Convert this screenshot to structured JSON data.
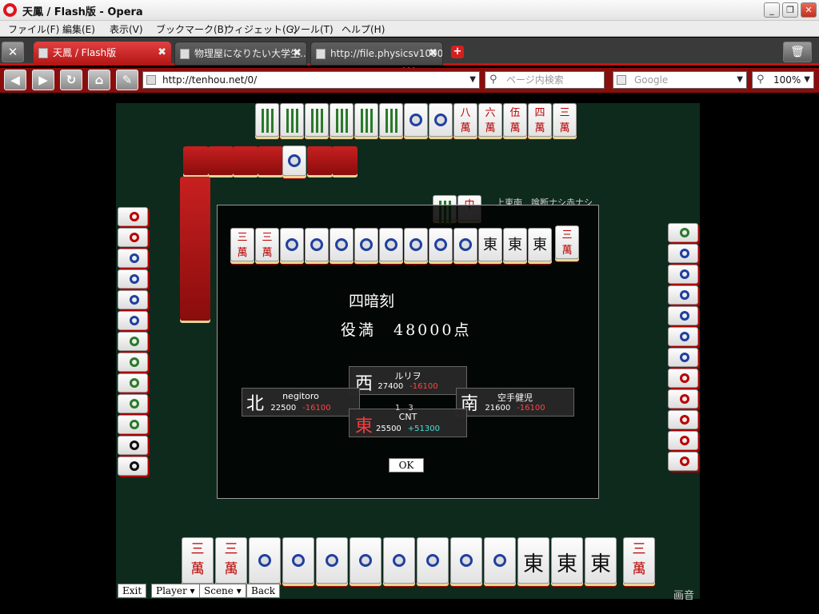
{
  "window": {
    "title": "天鳳 / Flash版 - Opera"
  },
  "menu": [
    "ファイル(F)",
    "編集(E)",
    "表示(V)",
    "ブックマーク(B)",
    "ウィジェット(G)",
    "ツール(T)",
    "ヘルプ(H)"
  ],
  "tabs": [
    {
      "label": "天鳳 / Flash版"
    },
    {
      "label": "物理屋になりたい大学生..."
    },
    {
      "label": "http://file.physicsv1000..."
    }
  ],
  "address": {
    "url": "http://tenhou.net/0/"
  },
  "search": {
    "placeholder": "ページ内検索"
  },
  "engine": {
    "label": "Google"
  },
  "zoom": {
    "label": "100%"
  },
  "game": {
    "rules": "上東南　喰断ナシ赤ナシ",
    "yaku": "四暗刻",
    "yakuman": "役満　48000点",
    "counter": "1　3",
    "ok_label": "OK",
    "players": {
      "west": {
        "wind": "西",
        "name": "ルリヲ",
        "score": "27400",
        "delta": "-16100"
      },
      "north": {
        "wind": "北",
        "name": "negitoro",
        "score": "22500",
        "delta": "-16100"
      },
      "south": {
        "wind": "南",
        "name": "空手健児",
        "score": "21600",
        "delta": "-16100"
      },
      "east": {
        "wind": "東",
        "name": "CNT",
        "score": "25500",
        "delta": "+51300"
      }
    },
    "buttons": {
      "exit": "Exit",
      "player": "Player ▾",
      "scene": "Scene ▾",
      "back": "Back"
    },
    "gaon": "画音"
  },
  "colors": {
    "accent": "#c41616",
    "felt": "#0e2a1c",
    "win": "#49e0d8",
    "loss": "#ff4545"
  }
}
